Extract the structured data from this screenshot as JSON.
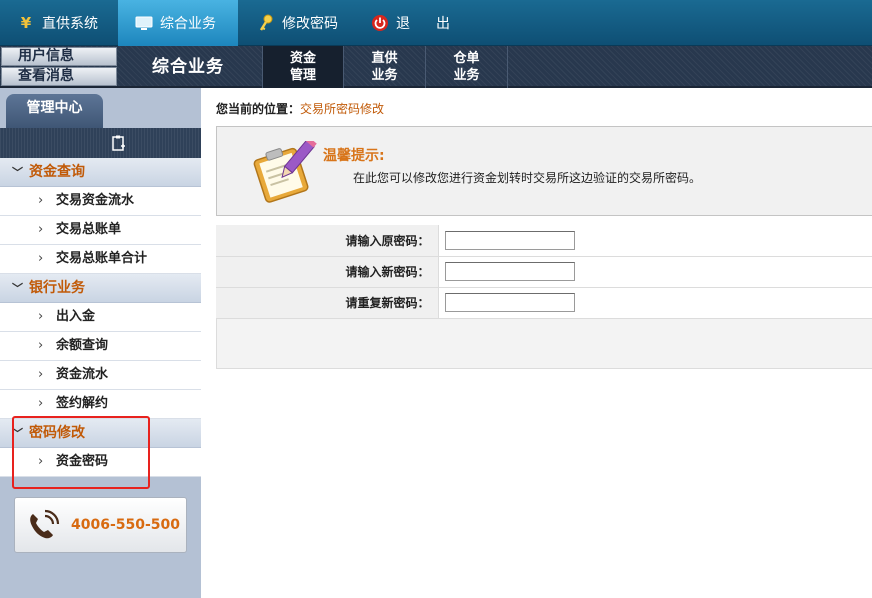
{
  "topbar": {
    "items": [
      {
        "label": "直供系统",
        "icon": "yen-icon"
      },
      {
        "label": "综合业务",
        "icon": "monitor-icon"
      },
      {
        "label": "修改密码",
        "icon": "key-icon"
      },
      {
        "label": "退　出",
        "icon": "power-icon"
      }
    ],
    "active_index": 1
  },
  "secondbar": {
    "user_info": "用户信息",
    "view_messages": "查看消息",
    "section_title": "综合业务",
    "tabs": [
      {
        "line1": "资金",
        "line2": "管理"
      },
      {
        "line1": "直供",
        "line2": "业务"
      },
      {
        "line1": "仓单",
        "line2": "业务"
      }
    ],
    "active_tab": 0
  },
  "sidebar": {
    "tab": "管理中心",
    "groups": [
      {
        "label": "资金查询",
        "items": [
          "交易资金流水",
          "交易总账单",
          "交易总账单合计"
        ]
      },
      {
        "label": "银行业务",
        "items": [
          "出入金",
          "余额查询",
          "资金流水",
          "签约解约"
        ]
      },
      {
        "label": "密码修改",
        "items": [
          "资金密码"
        ]
      }
    ],
    "phone": "4006-550-500"
  },
  "main": {
    "breadcrumb_label": "您当前的位置：",
    "breadcrumb_value": "交易所密码修改",
    "tip_title": "温馨提示:",
    "tip_text": "在此您可以修改您进行资金划转时交易所这边验证的交易所密码。",
    "form": [
      {
        "label": "请输入原密码：",
        "value": ""
      },
      {
        "label": "请输入新密码：",
        "value": ""
      },
      {
        "label": "请重复新密码：",
        "value": ""
      }
    ]
  },
  "colors": {
    "topbar": "#0e4f74",
    "active_top": "#2a9ad0",
    "accent_orange": "#c15a08",
    "highlight_red": "#e8221e",
    "sidebar_bg": "#b4c1d4"
  }
}
